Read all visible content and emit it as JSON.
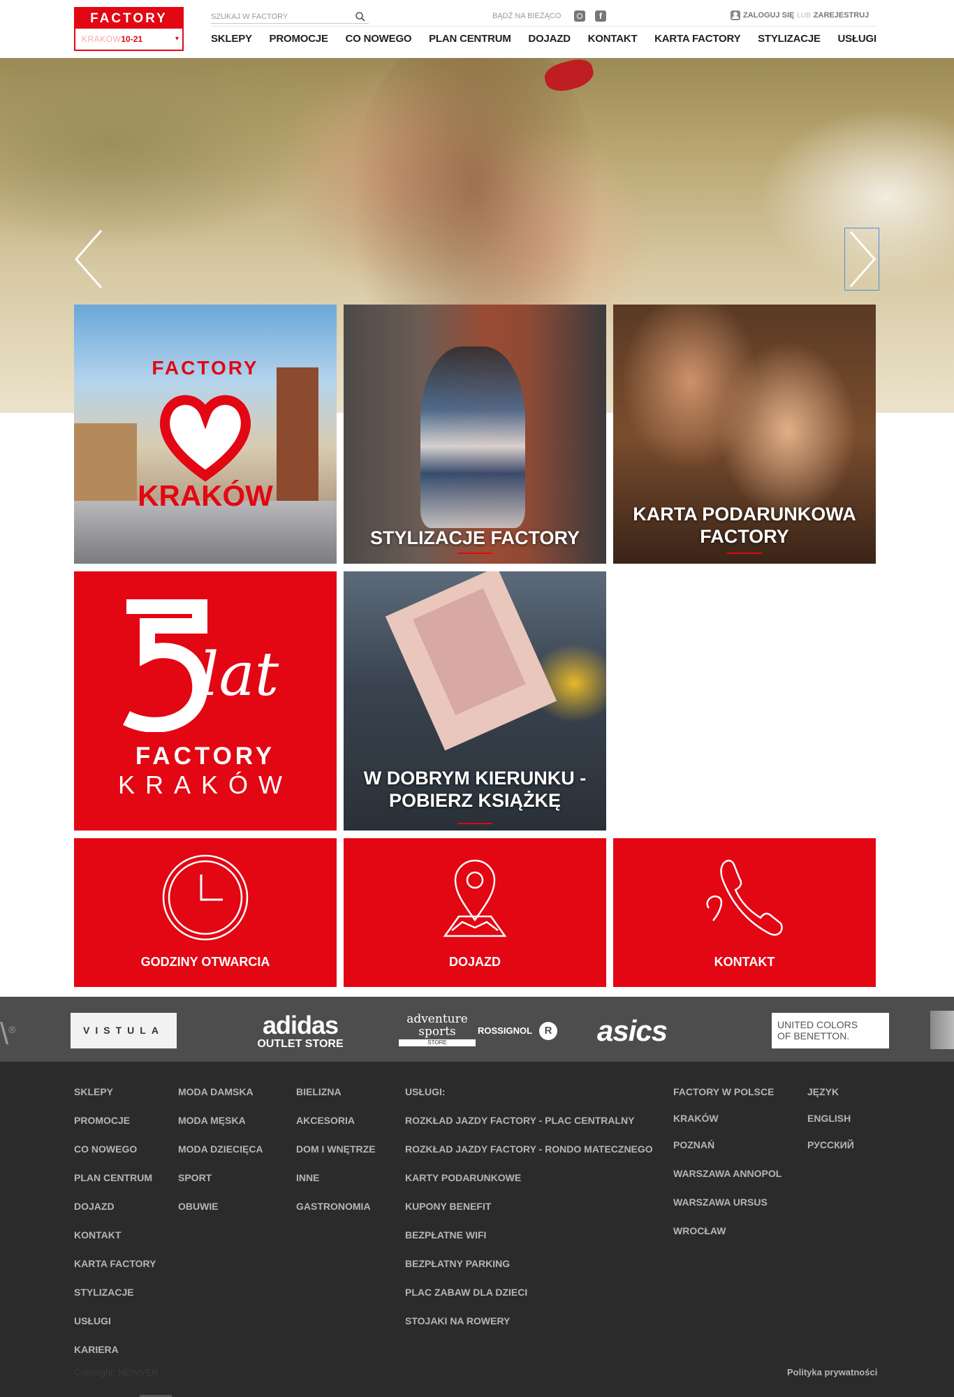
{
  "header": {
    "logo_brand": "FACTORY",
    "logo_city": "KRAKÓW",
    "logo_hours": "10-21",
    "search_placeholder": "SZUKAJ W FACTORY",
    "social_label": "BĄDŹ NA BIEŻĄCO",
    "login_label": "ZALOGUJ SIĘ",
    "login_or": "LUB",
    "register_label": "ZAREJESTRUJ",
    "nav": [
      "SKLEPY",
      "PROMOCJE",
      "CO NOWEGO",
      "PLAN CENTRUM",
      "DOJAZD",
      "KONTAKT",
      "KARTA FACTORY",
      "STYLIZACJE",
      "USŁUGI"
    ]
  },
  "tiles": {
    "krakow": {
      "brand": "FACTORY",
      "city": "KRAKÓW"
    },
    "stylizacje": {
      "title": "STYLIZACJE FACTORY"
    },
    "karta": {
      "title_line1": "KARTA PODARUNKOWA",
      "title_line2": "FACTORY"
    },
    "anniversary": {
      "number": "5",
      "word": "lat",
      "brand": "FACTORY",
      "city": "KRAKÓW"
    },
    "ksiazka": {
      "title_line1": "W DOBRYM KIERUNKU -",
      "title_line2": "POBIERZ KSIĄŻKĘ"
    }
  },
  "info_tiles": [
    "GODZINY OTWARCIA",
    "DOJAZD",
    "KONTAKT"
  ],
  "brands": {
    "vistula": "VISTULA",
    "adidas_1": "adidas",
    "adidas_2": "OUTLET STORE",
    "adventure_1": "adventure",
    "adventure_2": "sports",
    "adventure_3": "STORE",
    "rossignol": "ROSSIGNOL",
    "rossignol_badge": "R",
    "asics": "asics",
    "benetton_1": "UNITED COLORS",
    "benetton_2": "OF BENETTON.",
    "registered": "®"
  },
  "footer": {
    "col1": [
      "SKLEPY",
      "PROMOCJE",
      "CO NOWEGO",
      "PLAN CENTRUM",
      "DOJAZD",
      "KONTAKT",
      "KARTA FACTORY",
      "STYLIZACJE",
      "USŁUGI",
      "KARIERA"
    ],
    "col2": [
      "MODA DAMSKA",
      "MODA MĘSKA",
      "MODA DZIECIĘCA",
      "SPORT",
      "OBUWIE"
    ],
    "col3": [
      "BIELIZNA",
      "AKCESORIA",
      "DOM I WNĘTRZE",
      "INNE",
      "GASTRONOMIA"
    ],
    "col4_title": "USŁUGI:",
    "col4": [
      "ROZKŁAD JAZDY FACTORY - PLAC CENTRALNY",
      "ROZKŁAD JAZDY FACTORY - RONDO MATECZNEGO",
      "KARTY PODARUNKOWE",
      "KUPONY BENEFIT",
      "BEZPŁATNE WIFI",
      "BEZPŁATNY PARKING",
      "PLAC ZABAW DLA DZIECI",
      "STOJAKI NA ROWERY"
    ],
    "col5_title": "FACTORY W POLSCE",
    "col5": [
      "KRAKÓW",
      "POZNAŃ",
      "WARSZAWA ANNOPOL",
      "WARSZAWA URSUS",
      "WROCŁAW"
    ],
    "col6_title": "JĘZYK",
    "col6": [
      "ENGLISH",
      "РУССКИЙ"
    ],
    "copyright": "Copyright: NEINVER",
    "privacy": "Polityka prywatności"
  },
  "colors": {
    "brand_red": "#e30613",
    "footer_bg": "#2b2b2b",
    "brand_strip_bg": "#4d4d4d"
  }
}
